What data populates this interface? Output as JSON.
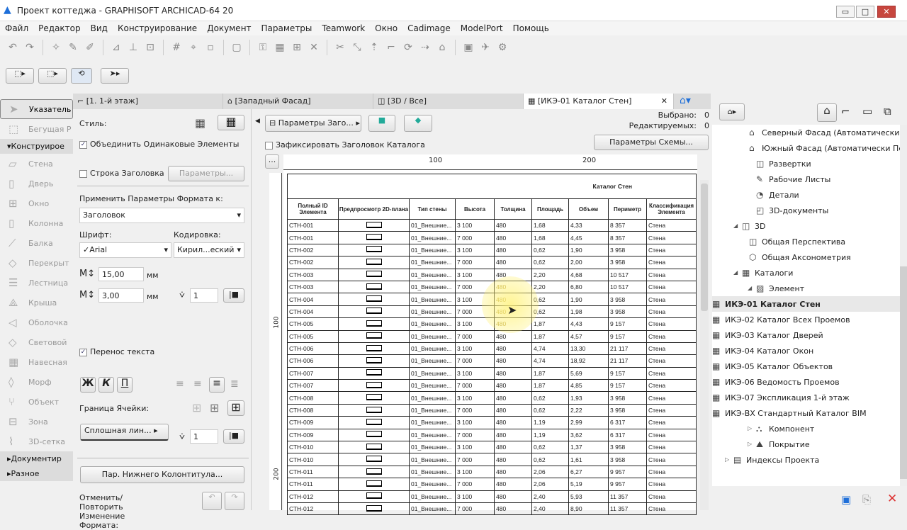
{
  "window": {
    "title": "Проект коттеджа - GRAPHISOFT ARCHICAD-64 20",
    "minimize": "▭",
    "maximize": "□",
    "close": "✕"
  },
  "menu": [
    "Файл",
    "Редактор",
    "Вид",
    "Конструирование",
    "Документ",
    "Параметры",
    "Teamwork",
    "Окно",
    "Cadimage",
    "ModelPort",
    "Помощь"
  ],
  "tabs": [
    {
      "label": "[1. 1-й этаж]"
    },
    {
      "label": "[Западный Фасад]"
    },
    {
      "label": "[3D / Все]"
    },
    {
      "label": "[ИКЭ-01 Каталог Стен]"
    }
  ],
  "toolbox": {
    "pointer": "Указатель",
    "marquee": "Бегущая Р",
    "design_group": "Конструирое",
    "tools": [
      "Стена",
      "Дверь",
      "Окно",
      "Колонна",
      "Балка",
      "Перекрыт",
      "Лестница",
      "Крыша",
      "Оболочка",
      "Световой",
      "Навесная",
      "Морф",
      "Объект",
      "Зона",
      "3D-сетка"
    ],
    "document_group": "Документир",
    "misc_group": "Разное"
  },
  "format": {
    "style_label": "Стиль:",
    "merge_label": "Объединить Одинаковые Элементы",
    "merge_checked": true,
    "header_row_label": "Строка Заголовка",
    "header_row_checked": false,
    "params_button": "Параметры...",
    "apply_label": "Применить Параметры Формата к:",
    "apply_value": "Заголовок",
    "font_label": "Шрифт:",
    "font_value": "✓Arial",
    "encoding_label": "Кодировка:",
    "encoding_value": "Кирил...еский",
    "size_value": "15,00",
    "size_unit": "мм",
    "spacing_value": "3,00",
    "spacing_unit": "мм",
    "pen_value": "1",
    "wrap_label": "Перенос текста",
    "wrap_checked": true,
    "bold": "Ж",
    "italic": "К",
    "underline": "П",
    "border_label": "Граница Ячейки:",
    "line_type": "Сплошная лин...",
    "border_pen": "1",
    "footer_button": "Пар. Нижнего Колонтитула...",
    "undo_label": "Отменить/Повторить Изменение Формата:"
  },
  "schedule_toolbar": {
    "header_params": "Параметры Заго...",
    "selected_label": "Выбрано:",
    "selected_value": "0",
    "editable_label": "Редактируемых:",
    "editable_value": "0",
    "fix_header_label": "Зафиксировать Заголовок Каталога",
    "scheme_button": "Параметры Схемы...",
    "more": "...",
    "ruler_100": "100",
    "ruler_200": "200",
    "vruler_100": "100",
    "vruler_200": "200"
  },
  "schedule": {
    "title": "Каталог Стен",
    "columns": [
      "Полный ID Элемента",
      "Предпросмотр 2D-плана",
      "Тип стены",
      "Высота",
      "Толщина",
      "Площадь",
      "Объем",
      "Периметр",
      "Классификация Элемента"
    ],
    "rows": [
      [
        "СТН-001",
        "01_Внешние...",
        "3 100",
        "480",
        "1,68",
        "4,33",
        "8 357",
        "Стена"
      ],
      [
        "СТН-001",
        "01_Внешние...",
        "7 000",
        "480",
        "1,68",
        "4,45",
        "8 357",
        "Стена"
      ],
      [
        "СТН-002",
        "01_Внешние...",
        "3 100",
        "480",
        "0,62",
        "1,90",
        "3 958",
        "Стена"
      ],
      [
        "СТН-002",
        "01_Внешние...",
        "7 000",
        "480",
        "0,62",
        "2,00",
        "3 958",
        "Стена"
      ],
      [
        "СТН-003",
        "01_Внешние...",
        "3 100",
        "480",
        "2,20",
        "4,68",
        "10 517",
        "Стена"
      ],
      [
        "СТН-003",
        "01_Внешние...",
        "7 000",
        "480",
        "2,20",
        "6,80",
        "10 517",
        "Стена"
      ],
      [
        "СТН-004",
        "01_Внешние...",
        "3 100",
        "480",
        "0,62",
        "1,90",
        "3 958",
        "Стена"
      ],
      [
        "СТН-004",
        "01_Внешние...",
        "7 000",
        "480",
        "0,62",
        "1,98",
        "3 958",
        "Стена"
      ],
      [
        "СТН-005",
        "01_Внешние...",
        "3 100",
        "480",
        "1,87",
        "4,43",
        "9 157",
        "Стена"
      ],
      [
        "СТН-005",
        "01_Внешние...",
        "7 000",
        "480",
        "1,87",
        "4,57",
        "9 157",
        "Стена"
      ],
      [
        "СТН-006",
        "01_Внешние...",
        "3 100",
        "480",
        "4,74",
        "13,30",
        "21 117",
        "Стена"
      ],
      [
        "СТН-006",
        "01_Внешние...",
        "7 000",
        "480",
        "4,74",
        "18,92",
        "21 117",
        "Стена"
      ],
      [
        "СТН-007",
        "01_Внешние...",
        "3 100",
        "480",
        "1,87",
        "5,69",
        "9 157",
        "Стена"
      ],
      [
        "СТН-007",
        "01_Внешние...",
        "7 000",
        "480",
        "1,87",
        "4,85",
        "9 157",
        "Стена"
      ],
      [
        "СТН-008",
        "01_Внешние...",
        "3 100",
        "480",
        "0,62",
        "1,93",
        "3 958",
        "Стена"
      ],
      [
        "СТН-008",
        "01_Внешние...",
        "7 000",
        "480",
        "0,62",
        "2,22",
        "3 958",
        "Стена"
      ],
      [
        "СТН-009",
        "01_Внешние...",
        "3 100",
        "480",
        "1,19",
        "2,99",
        "6 317",
        "Стена"
      ],
      [
        "СТН-009",
        "01_Внешние...",
        "7 000",
        "480",
        "1,19",
        "3,62",
        "6 317",
        "Стена"
      ],
      [
        "СТН-010",
        "01_Внешние...",
        "3 100",
        "480",
        "0,62",
        "1,37",
        "3 958",
        "Стена"
      ],
      [
        "СТН-010",
        "01_Внешние...",
        "7 000",
        "480",
        "0,62",
        "1,61",
        "3 958",
        "Стена"
      ],
      [
        "СТН-011",
        "01_Внешние...",
        "3 100",
        "480",
        "2,06",
        "6,27",
        "9 957",
        "Стена"
      ],
      [
        "СТН-011",
        "01_Внешние...",
        "7 000",
        "480",
        "2,06",
        "5,19",
        "9 957",
        "Стена"
      ],
      [
        "СТН-012",
        "01_Внешние...",
        "3 100",
        "480",
        "2,40",
        "5,93",
        "11 357",
        "Стена"
      ],
      [
        "СТН-012",
        "01_Внешние...",
        "7 000",
        "480",
        "2,40",
        "8,90",
        "11 357",
        "Стена"
      ]
    ]
  },
  "navigator": {
    "items": [
      {
        "label": "Северный Фасад (Автоматически П",
        "icon": "elevation-icon",
        "lvl": 2
      },
      {
        "label": "Южный Фасад (Автоматически Пер",
        "icon": "elevation-icon",
        "lvl": 2
      },
      {
        "label": "Развертки",
        "icon": "interior-elevation-icon",
        "lvl": 1
      },
      {
        "label": "Рабочие Листы",
        "icon": "worksheet-icon",
        "lvl": 1
      },
      {
        "label": "Детали",
        "icon": "detail-icon",
        "lvl": 1
      },
      {
        "label": "3D-документы",
        "icon": "3d-document-icon",
        "lvl": 1
      },
      {
        "label": "3D",
        "icon": "3d-icon",
        "lvl": 0,
        "open": true
      },
      {
        "label": "Общая Перспектива",
        "icon": "perspective-icon",
        "lvl": 2
      },
      {
        "label": "Общая Аксонометрия",
        "icon": "axonometry-icon",
        "lvl": 2
      },
      {
        "label": "Каталоги",
        "icon": "schedule-icon",
        "lvl": 0,
        "open": true
      },
      {
        "label": "Элемент",
        "icon": "element-icon",
        "lvl": 1,
        "open": true
      },
      {
        "label": "ИКЭ-01 Каталог Стен",
        "icon": "schedule-icon",
        "lvl": 3,
        "selected": true
      },
      {
        "label": "ИКЭ-02 Каталог Всех Проемов",
        "icon": "schedule-icon",
        "lvl": 3
      },
      {
        "label": "ИКЭ-03 Каталог Дверей",
        "icon": "schedule-icon",
        "lvl": 3
      },
      {
        "label": "ИКЭ-04 Каталог Окон",
        "icon": "schedule-icon",
        "lvl": 3
      },
      {
        "label": "ИКЭ-05 Каталог Объектов",
        "icon": "schedule-icon",
        "lvl": 3
      },
      {
        "label": "ИКЭ-06 Ведомость Проемов",
        "icon": "schedule-icon",
        "lvl": 3
      },
      {
        "label": "ИКЭ-07 Экспликация 1-й этаж",
        "icon": "schedule-icon",
        "lvl": 3
      },
      {
        "label": "ИКЭ-ВХ Стандартный Каталог BIM",
        "icon": "schedule-icon",
        "lvl": 3
      },
      {
        "label": "Компонент",
        "icon": "component-icon",
        "lvl": 1,
        "closed": true
      },
      {
        "label": "Покрытие",
        "icon": "surface-icon",
        "lvl": 1,
        "closed": true
      },
      {
        "label": "Индексы Проекта",
        "icon": "index-icon",
        "lvl": -1,
        "closed": true
      }
    ]
  },
  "colors": {
    "accent": "#1e6fd9",
    "highlight": "#ffef5a",
    "selected_row": "#e8e8e8"
  }
}
